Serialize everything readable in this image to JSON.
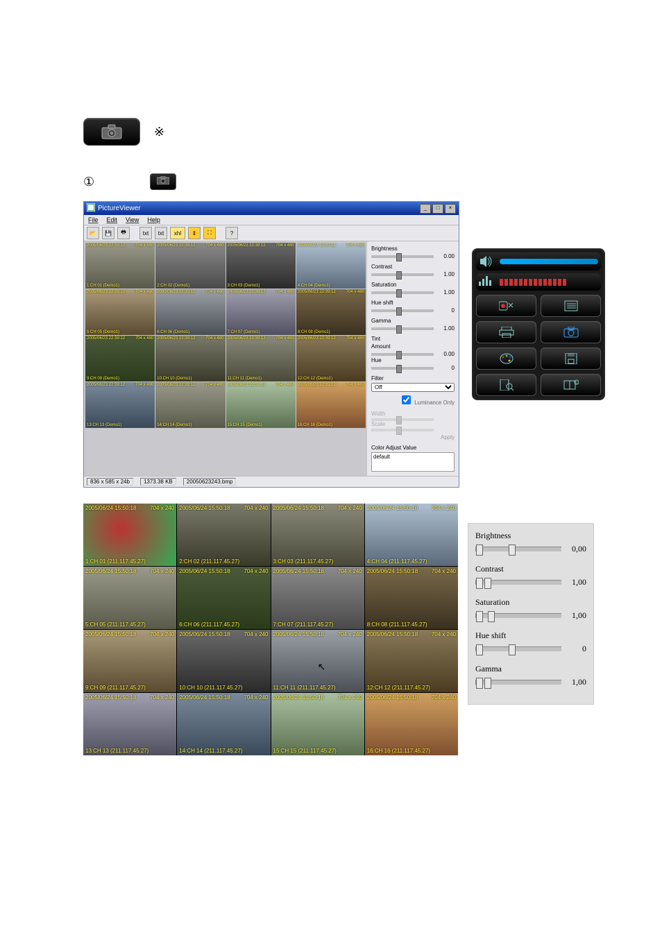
{
  "big_camera_button_label": "",
  "asterisk_glyph": "※",
  "circled_one_glyph": "①",
  "picture_viewer": {
    "title": "PictureViewer",
    "menu": [
      "File",
      "Edit",
      "View",
      "Help"
    ],
    "toolbar": [
      "open",
      "save",
      "print",
      "sep",
      "txt1",
      "txt2",
      "txt3",
      "fit-y",
      "fit",
      "help"
    ],
    "toolbar_txt": [
      "txt",
      "txt",
      "xhl"
    ],
    "status": {
      "dims": "836 x 585 x 24b",
      "size": "1373.38 KB",
      "file": "20050623243.bmp"
    },
    "side": {
      "sliders": [
        {
          "label": "Brightness",
          "value": "0.00"
        },
        {
          "label": "Contrast",
          "value": "1.00"
        },
        {
          "label": "Saturation",
          "value": "1.00"
        },
        {
          "label": "Hue shift",
          "value": "0"
        },
        {
          "label": "Gamma",
          "value": "1.00"
        }
      ],
      "tint_heading": "Tint",
      "tint_amount_label": "Amount",
      "tint_amount_value": "0.00",
      "tint_hue_label": "Hue",
      "tint_hue_value": "0",
      "filter_label": "Filter",
      "filter_value": "Off",
      "checkbox_label": "Luminance Only",
      "width_label": "Width",
      "width_value": "",
      "scale_label": "Scale",
      "scale_value": "",
      "apply_label": "Apply",
      "cav_label": "Color Adjust Value",
      "cav_value": "default"
    },
    "cells": [
      {
        "ts": "2005/06/23 22:39:12",
        "res": "704 x 480",
        "lbl": "1:CH 01 (Demo1)"
      },
      {
        "ts": "2005/06/23 22:39:12",
        "res": "704 x 480",
        "lbl": "2:CH 02 (Demo1)"
      },
      {
        "ts": "2005/06/23 22:39:12",
        "res": "704 x 480",
        "lbl": "3:CH 03 (Demo1)"
      },
      {
        "ts": "2005/06/23 22:39:12",
        "res": "704 x 480",
        "lbl": "4:CH 04 (Demo1)"
      },
      {
        "ts": "2005/06/23 22:39:12",
        "res": "704 x 480",
        "lbl": "5:CH 05 (Demo1)"
      },
      {
        "ts": "2005/06/23 22:39:12",
        "res": "704 x 480",
        "lbl": "6:CH 06 (Demo1)"
      },
      {
        "ts": "2005/06/23 22:39:12",
        "res": "704 x 480",
        "lbl": "7:CH 07 (Demo1)"
      },
      {
        "ts": "2005/06/23 22:39:12",
        "res": "704 x 480",
        "lbl": "8:CH 08 (Demo1)"
      },
      {
        "ts": "2005/06/23 22:39:12",
        "res": "704 x 480",
        "lbl": "9:CH 09 (Demo1)"
      },
      {
        "ts": "2005/06/23 22:39:12",
        "res": "704 x 480",
        "lbl": "10:CH 10 (Demo1)"
      },
      {
        "ts": "2005/06/23 22:39:12",
        "res": "704 x 480",
        "lbl": "11:CH 11 (Demo1)"
      },
      {
        "ts": "2005/06/23 22:39:12",
        "res": "704 x 480",
        "lbl": "12:CH 12 (Demo1)"
      },
      {
        "ts": "2005/06/23 22:39:12",
        "res": "704 x 480",
        "lbl": "13:CH 13 (Demo1)"
      },
      {
        "ts": "2005/06/23 22:39:12",
        "res": "704 x 480",
        "lbl": "14:CH 14 (Demo1)"
      },
      {
        "ts": "2005/06/23 22:39:12",
        "res": "704 x 480",
        "lbl": "15:CH 15 (Demo1)"
      },
      {
        "ts": "2005/06/23 22:39:12",
        "res": "704 x 480",
        "lbl": "16:CH 16 (Demo1)"
      }
    ]
  },
  "button_panel": {
    "speaker_icon": "speaker-icon",
    "eq_icon": "eq-icon",
    "buttons": [
      {
        "name": "record-settings-button",
        "icon": "record-wrench-icon"
      },
      {
        "name": "log-button",
        "icon": "list-icon"
      },
      {
        "name": "print-button",
        "icon": "printer-icon"
      },
      {
        "name": "capture-button",
        "icon": "camera-icon"
      },
      {
        "name": "color-button",
        "icon": "palette-icon"
      },
      {
        "name": "save-button",
        "icon": "floppy-icon"
      },
      {
        "name": "search-button",
        "icon": "file-search-icon"
      },
      {
        "name": "info-button",
        "icon": "book-info-icon"
      }
    ]
  },
  "big_grid": {
    "cells": [
      {
        "ts": "2005/06/24 15:50:18",
        "res": "704 x 240",
        "lbl": "1:CH 01 (211.117.45.27)"
      },
      {
        "ts": "2005/06/24 15:50:18",
        "res": "704 x 240",
        "lbl": "2:CH 02 (211.117.45.27)"
      },
      {
        "ts": "2005/06/24 15:50:18",
        "res": "704 x 240",
        "lbl": "3:CH 03 (211.117.45.27)"
      },
      {
        "ts": "2005/06/24 15:50:18",
        "res": "704 x 240",
        "lbl": "4:CH 04 (211.117.45.27)"
      },
      {
        "ts": "2005/06/24 15:50:18",
        "res": "704 x 240",
        "lbl": "5:CH 05 (211.117.45.27)"
      },
      {
        "ts": "2005/06/24 15:50:18",
        "res": "704 x 240",
        "lbl": "6:CH 06 (211.117.45.27)"
      },
      {
        "ts": "2005/06/24 15:50:18",
        "res": "704 x 240",
        "lbl": "7:CH 07 (211.117.45.27)"
      },
      {
        "ts": "2005/06/24 15:50:18",
        "res": "704 x 240",
        "lbl": "8:CH 08 (211.117.45.27)"
      },
      {
        "ts": "2005/06/24 15:50:18",
        "res": "704 x 240",
        "lbl": "9:CH 09 (211.117.45.27)"
      },
      {
        "ts": "2005/06/24 15:50:18",
        "res": "704 x 240",
        "lbl": "10:CH 10 (211.117.45.27)"
      },
      {
        "ts": "2005/06/24 15:50:18",
        "res": "704 x 240",
        "lbl": "11:CH 11 (211.117.45.27)"
      },
      {
        "ts": "2005/06/24 15:50:18",
        "res": "704 x 240",
        "lbl": "12:CH 12 (211.117.45.27)"
      },
      {
        "ts": "2005/06/24 15:50:18",
        "res": "704 x 240",
        "lbl": "13:CH 13 (211.117.45.27)"
      },
      {
        "ts": "2005/06/24 15:50:18",
        "res": "704 x 240",
        "lbl": "14:CH 14 (211.117.45.27)"
      },
      {
        "ts": "2005/06/24 15:50:18",
        "res": "704 x 240",
        "lbl": "15:CH 15 (211.117.45.27)"
      },
      {
        "ts": "2005/06/24 15:50:18",
        "res": "704 x 240",
        "lbl": "16:CH 16 (211.117.45.27)"
      }
    ]
  },
  "slider_panel": {
    "sliders": [
      {
        "label": "Brightness",
        "value": "0,00",
        "pos": 38
      },
      {
        "label": "Contrast",
        "value": "1,00",
        "pos": 10
      },
      {
        "label": "Saturation",
        "value": "1,00",
        "pos": 14
      },
      {
        "label": "Hue shift",
        "value": "0",
        "pos": 38
      },
      {
        "label": "Gamma",
        "value": "1,00",
        "pos": 10
      }
    ]
  }
}
